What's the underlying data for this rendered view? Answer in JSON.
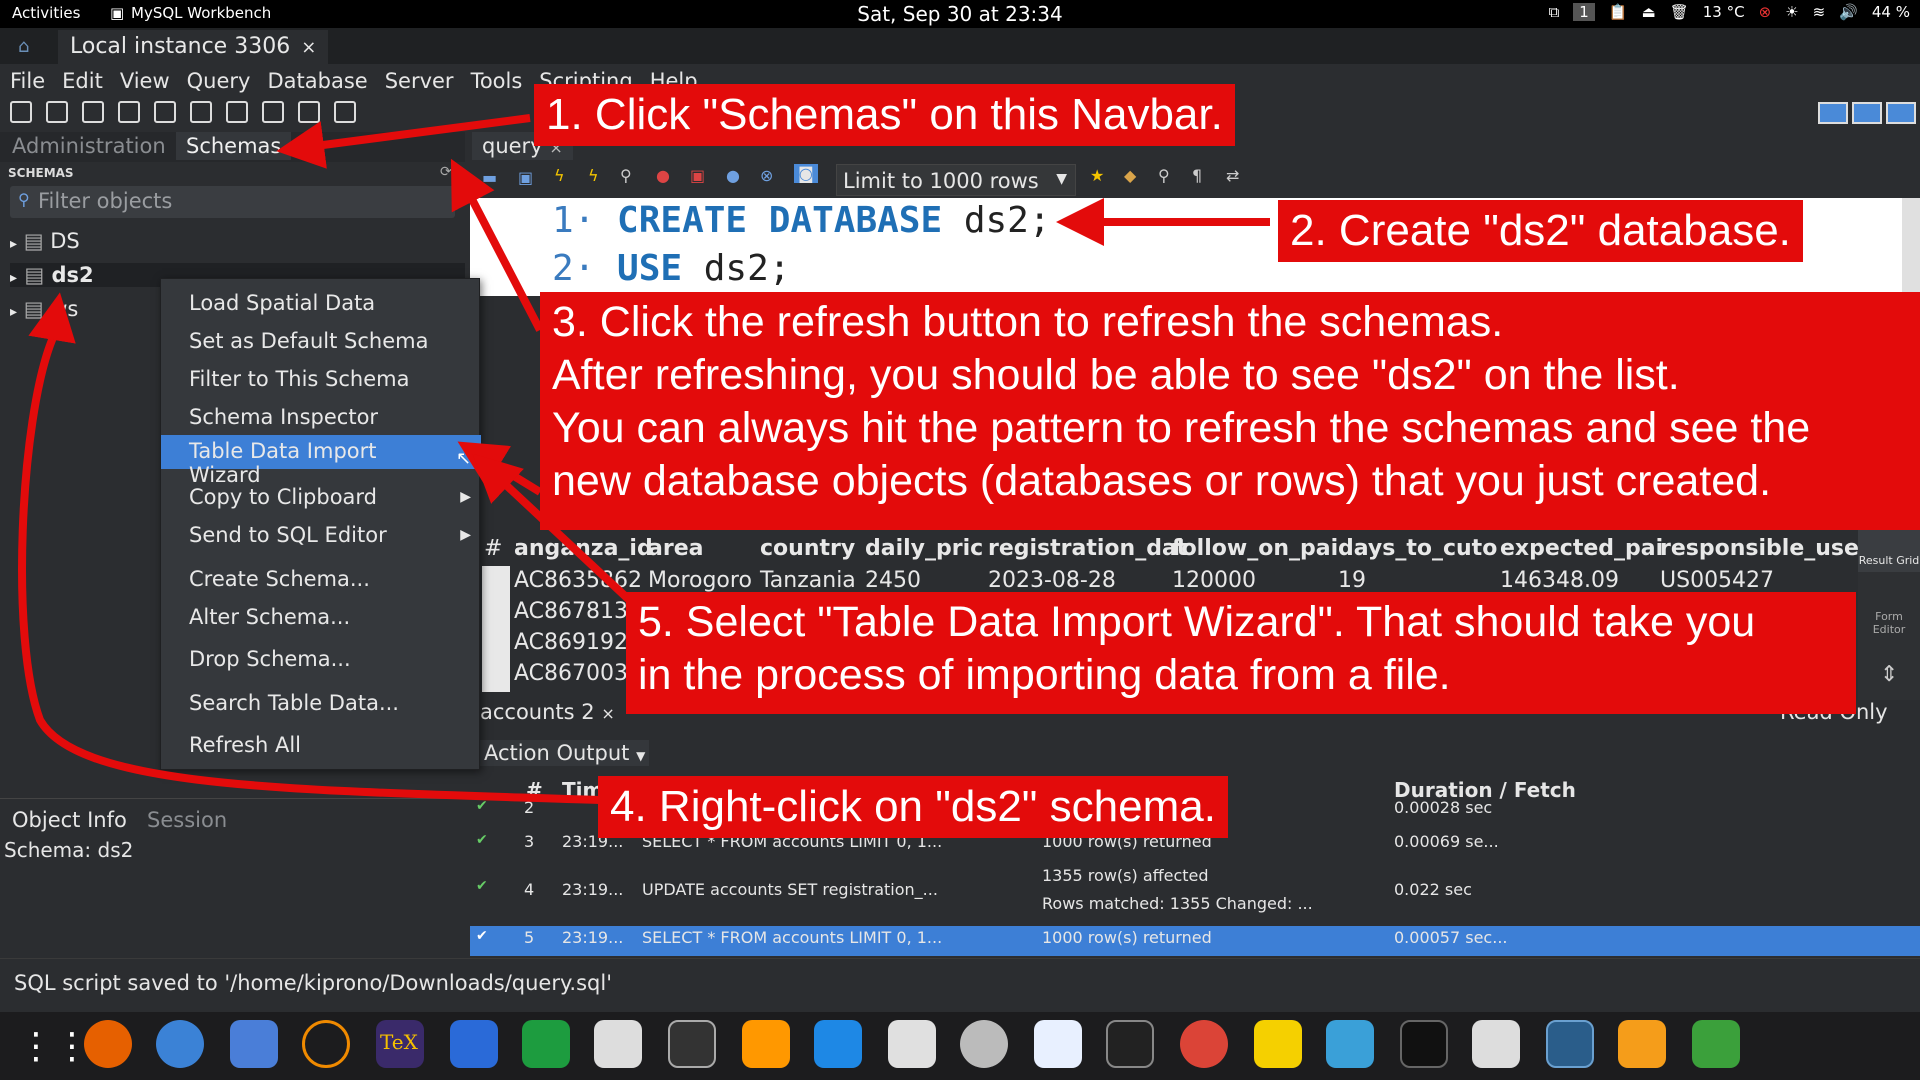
{
  "topbar": {
    "activities": "Activities",
    "app_name": "MySQL Workbench",
    "clock": "Sat, Sep 30 at 23:34",
    "workspace": "1",
    "weather": "13 °C",
    "battery": "44 %"
  },
  "window": {
    "tab_label": "Local instance 3306",
    "tab_close": "×"
  },
  "menu": [
    "File",
    "Edit",
    "View",
    "Query",
    "Database",
    "Server",
    "Tools",
    "Scripting",
    "Help"
  ],
  "left": {
    "tab_admin": "Administration",
    "tab_schemas": "Schemas",
    "header": "SCHEMAS",
    "filter_placeholder": "Filter objects",
    "tree": [
      "DS",
      "ds2",
      "ws"
    ],
    "tab_objinfo": "Object Info",
    "tab_session": "Session",
    "schema_info": "Schema: ds2"
  },
  "editor": {
    "tab": "query",
    "tab_close": "×",
    "limit": "Limit to 1000 rows",
    "lines": [
      {
        "num": "1·",
        "kw": "CREATE DATABASE",
        "rest": " ds2;"
      },
      {
        "num": "2·",
        "kw": "USE",
        "rest": " ds2;"
      }
    ]
  },
  "grid": {
    "headers": [
      "anganza_id",
      "area",
      "country",
      "daily_pric",
      "registration_dat",
      "follow_on_pai",
      "days_to_cuto",
      "expected_pai",
      "responsible_use"
    ],
    "rows": [
      [
        "AC8635862",
        "Morogoro",
        "Tanzania",
        "2450",
        "2023-08-28",
        "120000",
        "19",
        "146348.09",
        "US005427"
      ],
      [
        "AC867813"
      ],
      [
        "AC869192"
      ],
      [
        "AC867003"
      ]
    ],
    "result_grid": "Result Grid",
    "form_editor": "Form Editor",
    "results_tab": "accounts 2",
    "readonly": "Read Only"
  },
  "output": {
    "dropdown": "Action Output",
    "col_num": "#",
    "col_time": "Time",
    "col_duration": "Duration / Fetch",
    "rows": [
      {
        "n": "2",
        "time": "",
        "action": "",
        "msg": "",
        "dur": "0.00028 sec"
      },
      {
        "n": "3",
        "time": "23:19...",
        "action": "SELECT * FROM accounts LIMIT 0, 1...",
        "msg": "1000 row(s) returned",
        "dur": "0.00069 se..."
      },
      {
        "n": "4",
        "time": "23:19...",
        "action": "UPDATE accounts SET registration_...",
        "msg": "1355 row(s) affected",
        "msg2": "Rows matched: 1355  Changed: ...",
        "dur": "0.022 sec"
      },
      {
        "n": "5",
        "time": "23:19...",
        "action": "SELECT * FROM accounts LIMIT 0, 1...",
        "msg": "1000 row(s) returned",
        "dur": "0.00057 sec..."
      }
    ]
  },
  "status": "SQL script saved to '/home/kiprono/Downloads/query.sql'",
  "context_menu": [
    "Load Spatial Data",
    "Set as Default Schema",
    "Filter to This Schema",
    "Schema Inspector",
    "Table Data Import Wizard",
    "Copy to Clipboard",
    "Send to SQL Editor",
    "Create Schema...",
    "Alter Schema...",
    "Drop Schema...",
    "Search Table Data...",
    "Refresh All"
  ],
  "annotations": {
    "a1": "1. Click \"Schemas\" on this Navbar.",
    "a2": "2. Create \"ds2\" database.",
    "a3_l1": "3. Click the refresh button to refresh the schemas.",
    "a3_l2": "After refreshing, you should be able to see \"ds2\" on the list.",
    "a3_l3": "You can always hit the pattern to refresh the schemas and see the",
    "a3_l4": "new database objects (databases or rows) that you just created.",
    "a4": "4. Right-click on \"ds2\" schema.",
    "a5_l1": "5. Select \"Table Data Import Wizard\". That should take you",
    "a5_l2": "in the process of importing data from a file."
  },
  "colors": {
    "annotation": "#e30b0b",
    "selection": "#3d7fd6",
    "keyword": "#1f6fb5"
  }
}
